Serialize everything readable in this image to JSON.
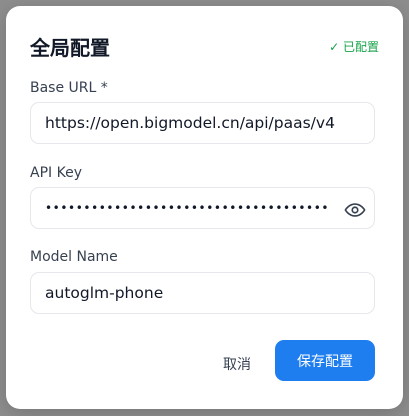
{
  "dialog": {
    "title": "全局配置",
    "status": "✓ 已配置"
  },
  "base_url": {
    "label": "Base URL *",
    "value": "https://open.bigmodel.cn/api/paas/v4"
  },
  "api_key": {
    "label": "API Key",
    "value": "••••••••••••••••••••••••••••••••••••••",
    "toggle_icon": "eye-icon"
  },
  "model_name": {
    "label": "Model Name",
    "value": "autoglm-phone"
  },
  "actions": {
    "cancel_label": "取消",
    "save_label": "保存配置"
  },
  "colors": {
    "primary": "#1e7ef0",
    "success": "#16a34a"
  }
}
